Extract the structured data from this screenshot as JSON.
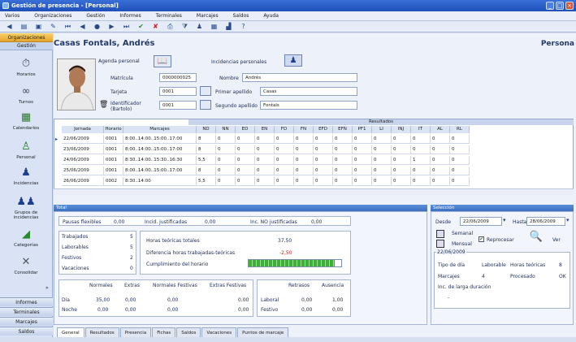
{
  "window": {
    "title": "Gestión de presencia - [Personal]"
  },
  "menu": [
    "Varios",
    "Organizaciones",
    "Gestión",
    "Informes",
    "Terminales",
    "Marcajes",
    "Saldos",
    "Ayuda"
  ],
  "sidebar": {
    "header": "Organizaciones",
    "sub": "Gestión",
    "items": [
      {
        "label": "Horarios",
        "icon": "clock-icon"
      },
      {
        "label": "Turnos",
        "icon": "shift-icon"
      },
      {
        "label": "Calendarios",
        "icon": "calendar-icon"
      },
      {
        "label": "Personal",
        "icon": "person-icon"
      },
      {
        "label": "Incidencias",
        "icon": "incidence-icon"
      },
      {
        "label": "Grupos de incidencias",
        "icon": "group-icon"
      },
      {
        "label": "Categorías",
        "icon": "category-icon"
      },
      {
        "label": "Consolidar",
        "icon": "tools-icon"
      }
    ],
    "bottom": [
      "Informes",
      "Terminales",
      "Marcajes",
      "Saldos"
    ]
  },
  "header": {
    "title": "Casas Fontals, Andrés",
    "right": "Persona"
  },
  "form": {
    "agenda_label": "Agenda personal",
    "incidencias_label": "Incidencias personales",
    "matricula_label": "Matrícula",
    "matricula": "0000000025",
    "tarjeta_label": "Tarjeta",
    "tarjeta": "0001",
    "identificador_label": "Identificador (Bartolo)",
    "identificador": "0001",
    "nombre_label": "Nombre",
    "nombre": "Andrés",
    "primer_label": "Primer apellido",
    "primer": "Casas",
    "segundo_label": "Segundo apellido",
    "segundo": "Fontals"
  },
  "grid": {
    "group_header": "Resultados",
    "columns": [
      "Jornada",
      "Horario",
      "Marcajes",
      "ND",
      "NN",
      "ED",
      "EN",
      "FD",
      "FN",
      "EFD",
      "EFN",
      "PF1",
      "LI",
      "INJ",
      "IT",
      "AL",
      "RL"
    ],
    "rows": [
      [
        "22/06/2009",
        "0001",
        "8:00..14:00..15:00..17:00",
        "8",
        "0",
        "0",
        "0",
        "0",
        "0",
        "0",
        "0",
        "0",
        "0",
        "0",
        "0",
        "0",
        "0"
      ],
      [
        "23/06/2009",
        "0001",
        "8:00..14:00..15:00..17:00",
        "8",
        "0",
        "0",
        "0",
        "0",
        "0",
        "0",
        "0",
        "0",
        "0",
        "0",
        "0",
        "0",
        "0"
      ],
      [
        "24/06/2009",
        "0001",
        "8:30..14:00..15:30..16:30",
        "5,5",
        "0",
        "0",
        "0",
        "0",
        "0",
        "0",
        "0",
        "0",
        "0",
        "0",
        "1",
        "0",
        "0"
      ],
      [
        "25/06/2009",
        "0001",
        "8:00..14:00..15:00..17:00",
        "8",
        "0",
        "0",
        "0",
        "0",
        "0",
        "0",
        "0",
        "0",
        "0",
        "0",
        "0",
        "0",
        "0"
      ],
      [
        "26/06/2009",
        "0002",
        "8:30..14:00",
        "5,5",
        "0",
        "0",
        "0",
        "0",
        "0",
        "0",
        "0",
        "0",
        "0",
        "0",
        "0",
        "0",
        "0"
      ]
    ]
  },
  "total": {
    "title": "Total",
    "pausas_label": "Pausas flexibles",
    "pausas": "0,00",
    "justif_label": "Incid. justificadas",
    "justif": "0,00",
    "nojustif_label": "Inc. NO justificadas",
    "nojustif": "0,00",
    "days": [
      {
        "label": "Trabajados",
        "value": "5"
      },
      {
        "label": "Laborables",
        "value": "5"
      },
      {
        "label": "Festivos",
        "value": "2"
      },
      {
        "label": "Vacaciones",
        "value": "0"
      }
    ],
    "hours": [
      {
        "label": "Horas teóricas totales",
        "value": "37,50"
      },
      {
        "label": "Diferencia horas trabajadas-teóricas",
        "value": "-2,50"
      },
      {
        "label": "Cumplimiento del horario",
        "value": ""
      }
    ],
    "cumplimiento": 0.93,
    "hours_table": {
      "headers": [
        "Normales",
        "Extras",
        "Normales Festivas",
        "Extras Festivas"
      ],
      "rows": [
        {
          "label": "Día",
          "values": [
            "35,00",
            "0,00",
            "0,00",
            "0,00"
          ]
        },
        {
          "label": "Noche",
          "values": [
            "0,00",
            "0,00",
            "0,00",
            "0,00"
          ]
        }
      ]
    },
    "ret_table": {
      "headers": [
        "Retrasos",
        "Ausencia"
      ],
      "rows": [
        {
          "label": "Laboral",
          "values": [
            "0,00",
            "1,00"
          ]
        },
        {
          "label": "Festivo",
          "values": [
            "0,00",
            "0,00"
          ]
        }
      ]
    }
  },
  "seleccion": {
    "title": "Selección",
    "desde_label": "Desde",
    "desde": "22/06/2009",
    "hasta_label": "Hasta",
    "hasta": "28/06/2009",
    "semanal": "Semanal",
    "mensual": "Mensual",
    "reprocesar": "Reprocesar",
    "ver": "Ver",
    "fecha": "22/06/2009",
    "tipo_label": "Tipo de día",
    "tipo": "Laborable",
    "teoricas_label": "Horas teóricas",
    "teoricas": "8",
    "marcajes_label": "Marcajes",
    "marcajes": "4",
    "procesado_label": "Procesado",
    "procesado": "OK",
    "larga_label": "Inc. de larga duración",
    "larga": "-"
  },
  "tabs": [
    "General",
    "Resultados",
    "Presencia",
    "Fichas",
    "Saldos",
    "Vacaciones",
    "Puntos de marcaje"
  ]
}
